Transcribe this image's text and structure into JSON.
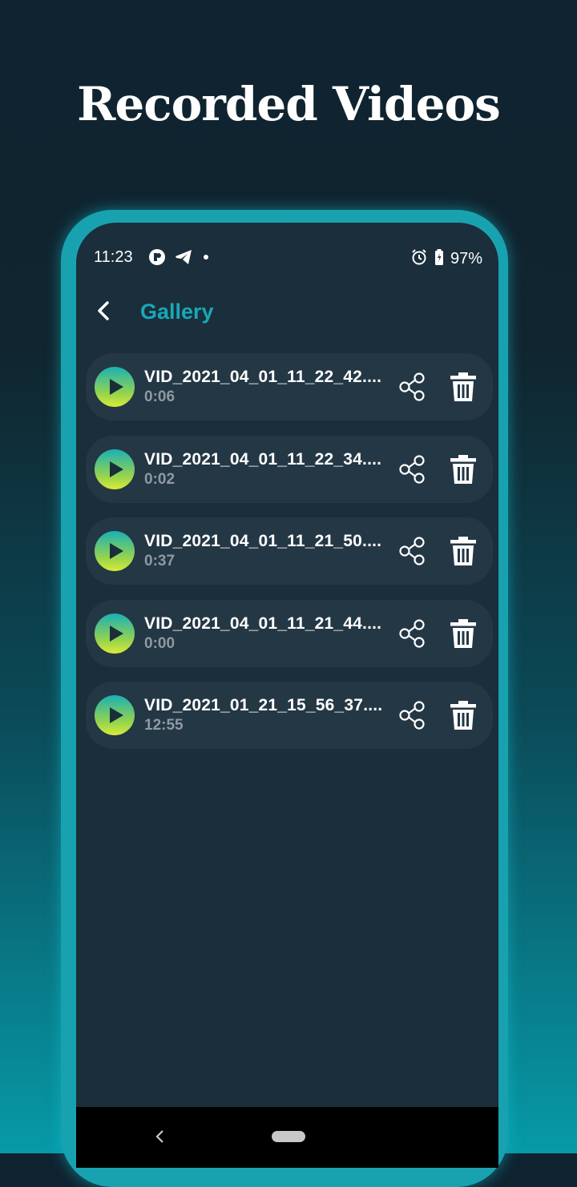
{
  "headline": "Recorded Videos",
  "status_bar": {
    "time": "11:23",
    "battery": "97%"
  },
  "app_bar": {
    "title": "Gallery"
  },
  "videos": [
    {
      "name": "VID_2021_04_01_11_22_42....",
      "duration": "0:06"
    },
    {
      "name": "VID_2021_04_01_11_22_34....",
      "duration": "0:02"
    },
    {
      "name": "VID_2021_04_01_11_21_50....",
      "duration": "0:37"
    },
    {
      "name": "VID_2021_04_01_11_21_44....",
      "duration": "0:00"
    },
    {
      "name": "VID_2021_01_21_15_56_37....",
      "duration": "12:55"
    }
  ],
  "colors": {
    "accent": "#18a8b8",
    "card": "#243745",
    "screen": "#1b2e3b"
  }
}
